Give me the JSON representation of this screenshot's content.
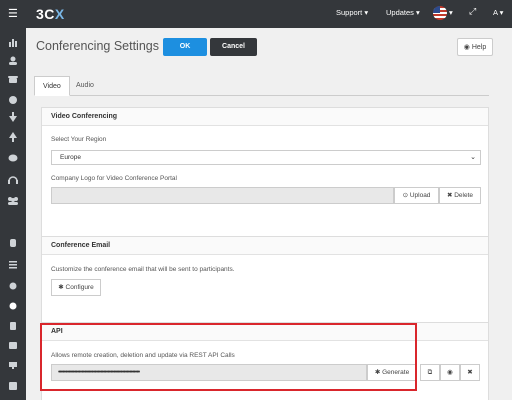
{
  "topbar": {
    "logo_a": "3C",
    "logo_b": "X",
    "menu_icon": "☰",
    "support": "Support ▾",
    "updates": "Updates ▾",
    "lang_chevron": "▾",
    "expand": "⤢",
    "user": "A ▾"
  },
  "sidebar_icons": [
    "chart-icon",
    "user-icon",
    "phone-icon",
    "globe-icon",
    "download-icon",
    "upload-icon",
    "chat-icon",
    "headset-icon",
    "group-icon",
    "database-icon",
    "list-icon",
    "circle-icon",
    "gear-icon",
    "document-icon",
    "book-icon",
    "desktop-icon",
    "save-icon"
  ],
  "page": {
    "title": "Conferencing Settings",
    "ok": "OK",
    "cancel": "Cancel",
    "help": "Help",
    "help_icon": "◉"
  },
  "tabs": [
    "Video",
    "Audio"
  ],
  "video_panel": {
    "heading": "Video Conferencing",
    "region_label": "Select Your Region",
    "region_value": "Europe",
    "logo_label": "Company Logo for Video Conference Portal",
    "upload": "Upload",
    "delete": "Delete"
  },
  "email_panel": {
    "heading": "Conference Email",
    "description": "Customize the conference email that will be sent to participants.",
    "configure": "Configure"
  },
  "api_panel": {
    "heading": "API",
    "description": "Allows remote creation, deletion and update via REST API Calls",
    "key_mask": "••••••••••••••••••••••••••••••••••••••••••••••••••••••••",
    "generate": "Generate"
  }
}
